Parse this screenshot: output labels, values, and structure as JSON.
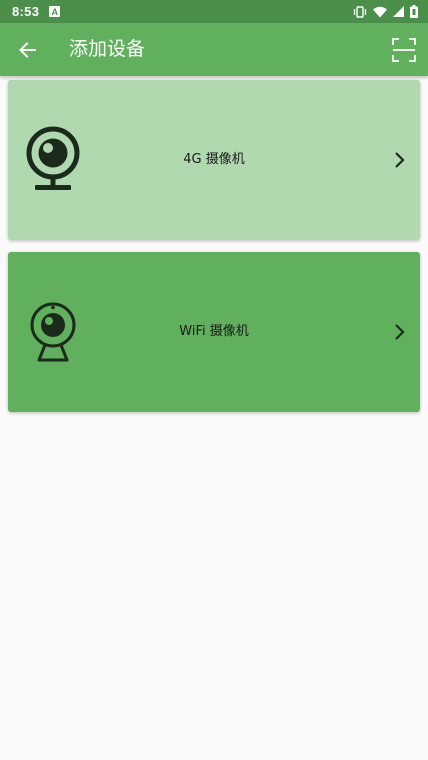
{
  "status_bar": {
    "time": "8:53",
    "notification_icon": "a-icon",
    "icons": [
      "vibrate-icon",
      "wifi-icon",
      "signal-icon",
      "battery-icon"
    ]
  },
  "app_bar": {
    "title": "添加设备",
    "back_icon": "arrow-left-icon",
    "scan_icon": "scan-frame-icon"
  },
  "devices": [
    {
      "label": "4G 摄像机",
      "icon": "webcam-icon",
      "bg_color": "#b0d9b0"
    },
    {
      "label": "WiFi 摄像机",
      "icon": "wifi-camera-icon",
      "bg_color": "#60b05d"
    }
  ],
  "colors": {
    "status_bar": "#4c8f4b",
    "primary": "#60b05d",
    "card_light": "#b0d9b0",
    "background": "#fafafa",
    "icon_dark": "#1b2a1b"
  }
}
